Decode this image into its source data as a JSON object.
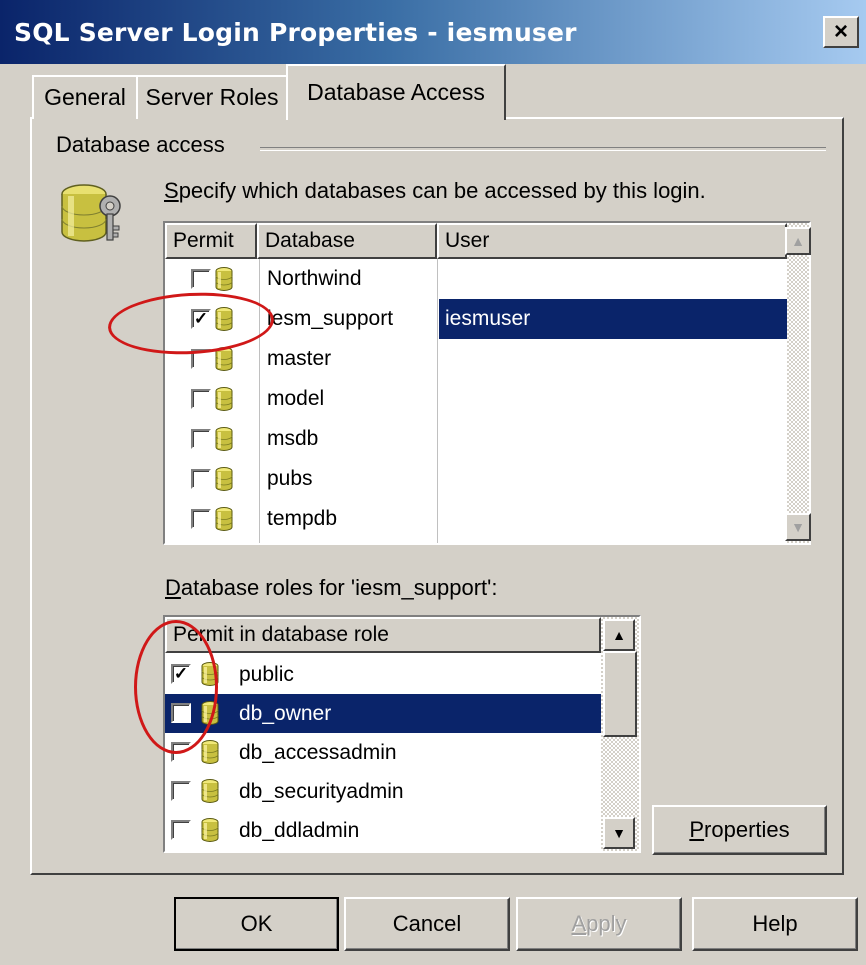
{
  "window": {
    "title": "SQL Server Login Properties - iesmuser",
    "close_glyph": "×"
  },
  "tabs": [
    {
      "label": "General",
      "active": false
    },
    {
      "label": "Server Roles",
      "active": false
    },
    {
      "label": "Database Access",
      "active": true
    }
  ],
  "group": {
    "label": "Database access",
    "icon": "database-security-icon",
    "specify_prefix": "S",
    "specify_rest": "pecify which databases can be accessed by this login."
  },
  "db_table": {
    "columns": [
      "Permit",
      "Database",
      "User"
    ],
    "rows": [
      {
        "database": "Northwind",
        "user": "",
        "checked": false,
        "selected": false
      },
      {
        "database": "iesm_support",
        "user": "iesmuser",
        "checked": true,
        "selected": true
      },
      {
        "database": "master",
        "user": "",
        "checked": false,
        "selected": false
      },
      {
        "database": "model",
        "user": "",
        "checked": false,
        "selected": false
      },
      {
        "database": "msdb",
        "user": "",
        "checked": false,
        "selected": false
      },
      {
        "database": "pubs",
        "user": "",
        "checked": false,
        "selected": false
      },
      {
        "database": "tempdb",
        "user": "",
        "checked": false,
        "selected": false
      }
    ]
  },
  "roles": {
    "label_prefix": "D",
    "label_rest": "atabase roles for 'iesm_support':",
    "column": "Permit in database role",
    "rows": [
      {
        "role": "public",
        "checked": true,
        "selected": false
      },
      {
        "role": "db_owner",
        "checked": true,
        "selected": true
      },
      {
        "role": "db_accessadmin",
        "checked": false,
        "selected": false
      },
      {
        "role": "db_securityadmin",
        "checked": false,
        "selected": false
      },
      {
        "role": "db_ddladmin",
        "checked": false,
        "selected": false
      }
    ]
  },
  "buttons": {
    "properties_prefix": "P",
    "properties_rest": "roperties",
    "ok": "OK",
    "cancel": "Cancel",
    "apply_prefix": "A",
    "apply_rest": "pply",
    "help": "Help"
  },
  "colors": {
    "selection": "#0a246a",
    "annotation": "#d01818",
    "face": "#d4d0c8"
  }
}
